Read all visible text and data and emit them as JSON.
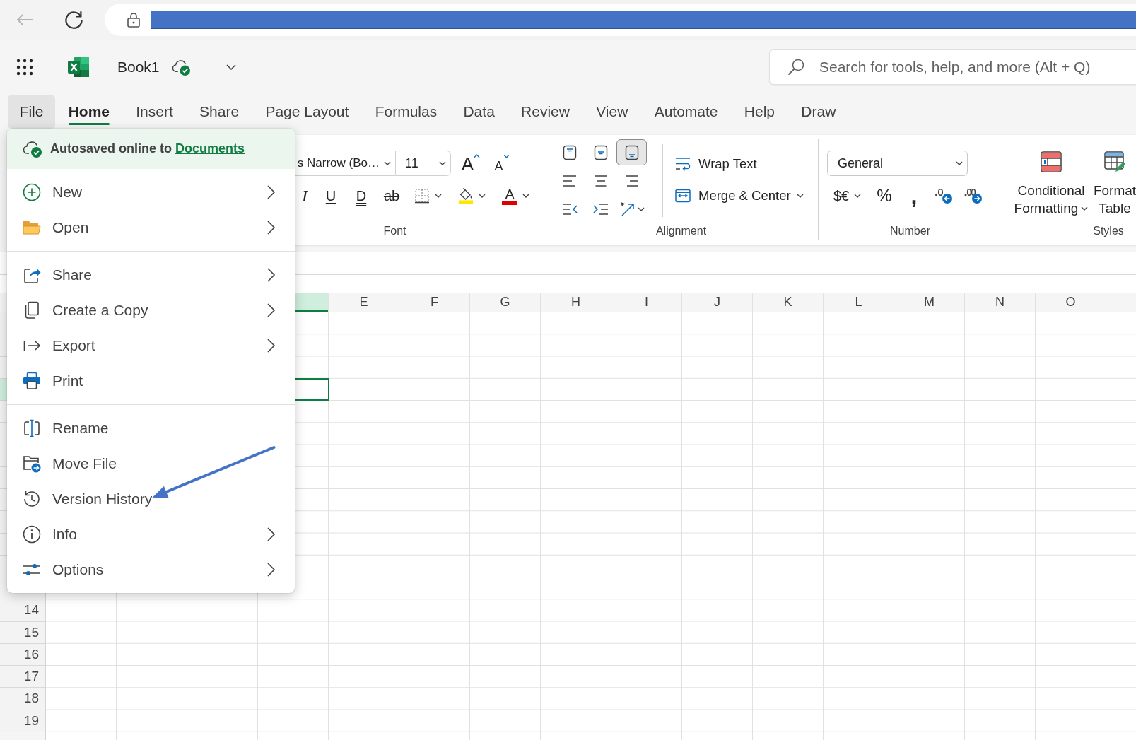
{
  "browser": {
    "back_button": {
      "disabled": true
    }
  },
  "app_bar": {
    "title": "Book1",
    "search": {
      "placeholder": "Search for tools, help, and more (Alt + Q)"
    }
  },
  "file_button": {
    "label": "File",
    "expanded": true
  },
  "tabs": [
    {
      "label": "Home",
      "selected": true
    },
    {
      "label": "Insert",
      "selected": false
    },
    {
      "label": "Share",
      "selected": false
    },
    {
      "label": "Page Layout",
      "selected": false
    },
    {
      "label": "Formulas",
      "selected": false
    },
    {
      "label": "Data",
      "selected": false
    },
    {
      "label": "Review",
      "selected": false
    },
    {
      "label": "View",
      "selected": false
    },
    {
      "label": "Automate",
      "selected": false
    },
    {
      "label": "Help",
      "selected": false
    },
    {
      "label": "Draw",
      "selected": false
    }
  ],
  "ribbon": {
    "font": {
      "font_name": "s Narrow (Bo…",
      "font_size": "11",
      "size_buttons": [
        {
          "kind": "grow",
          "glyph": "A"
        },
        {
          "kind": "shrink",
          "glyph": "A"
        }
      ],
      "format_buttons": [
        {
          "kind": "italic",
          "glyph": "I",
          "dropdown": false
        },
        {
          "kind": "underline",
          "glyph": "U",
          "dropdown": false
        },
        {
          "kind": "double_underline",
          "glyph": "D",
          "dropdown": false
        },
        {
          "kind": "strikethrough",
          "glyph": "ab",
          "dropdown": false
        },
        {
          "kind": "borders",
          "dropdown": true
        },
        {
          "kind": "fill_color",
          "dropdown": true
        },
        {
          "kind": "font_color",
          "glyph": "A",
          "dropdown": true
        }
      ],
      "label": "Font"
    },
    "alignment": {
      "buttons": [
        {
          "kind": "top",
          "selected": false,
          "dropdown": false
        },
        {
          "kind": "middle",
          "selected": false,
          "dropdown": false
        },
        {
          "kind": "bottom",
          "selected": true,
          "dropdown": false
        },
        {
          "kind": "left",
          "selected": false,
          "dropdown": false
        },
        {
          "kind": "center",
          "selected": false,
          "dropdown": false
        },
        {
          "kind": "right",
          "selected": false,
          "dropdown": false
        },
        {
          "kind": "outdent",
          "selected": false,
          "dropdown": false
        },
        {
          "kind": "indent",
          "selected": false,
          "dropdown": false
        },
        {
          "kind": "orientation",
          "selected": false,
          "dropdown": true
        }
      ],
      "commands": [
        {
          "kind": "wrap",
          "label": "Wrap Text",
          "dropdown": false
        },
        {
          "kind": "merge",
          "label": "Merge & Center",
          "dropdown": true
        }
      ],
      "label": "Alignment"
    },
    "number": {
      "format": "General",
      "buttons": [
        {
          "kind": "currency",
          "glyph": "$€",
          "dropdown": true
        },
        {
          "kind": "percent",
          "glyph": "%",
          "dropdown": false
        },
        {
          "kind": "comma",
          "glyph": ",",
          "dropdown": false
        },
        {
          "kind": "decrease_decimal",
          "dropdown": false
        },
        {
          "kind": "increase_decimal",
          "dropdown": false
        }
      ],
      "label": "Number"
    },
    "styles": {
      "buttons": [
        {
          "kind": "conditional_formatting",
          "lines": [
            "Conditional",
            "Formatting"
          ],
          "dropdown": true
        },
        {
          "kind": "format_table",
          "lines": [
            "Format",
            "Table"
          ],
          "dropdown": false
        }
      ],
      "label": "Styles"
    }
  },
  "file_menu": {
    "status": "Autosaved online to",
    "link": "Documents",
    "sections": [
      {
        "items": [
          {
            "label": "New",
            "submenu": true
          },
          {
            "label": "Open",
            "submenu": true
          }
        ]
      },
      {
        "items": [
          {
            "label": "Share",
            "submenu": true
          },
          {
            "label": "Create a Copy",
            "submenu": true
          },
          {
            "label": "Export",
            "submenu": true
          },
          {
            "label": "Print",
            "submenu": false
          }
        ]
      },
      {
        "items": [
          {
            "label": "Rename",
            "submenu": false
          },
          {
            "label": "Move File",
            "submenu": false
          },
          {
            "label": "Version History",
            "submenu": false
          },
          {
            "label": "Info",
            "submenu": true
          },
          {
            "label": "Options",
            "submenu": true
          }
        ]
      }
    ]
  },
  "sheet": {
    "columns": [
      {
        "selected": true
      },
      {
        "label": "E",
        "selected": false
      },
      {
        "label": "F",
        "selected": false
      },
      {
        "label": "G",
        "selected": false
      },
      {
        "label": "H",
        "selected": false
      },
      {
        "label": "I",
        "selected": false
      },
      {
        "label": "J",
        "selected": false
      },
      {
        "label": "K",
        "selected": false
      },
      {
        "label": "L",
        "selected": false
      },
      {
        "label": "M",
        "selected": false
      },
      {
        "label": "N",
        "selected": false
      },
      {
        "label": "O",
        "selected": false
      }
    ],
    "rows": [
      {
        "selected": false
      },
      {
        "selected": false
      },
      {
        "selected": false
      },
      {
        "selected": true
      },
      {
        "selected": false
      },
      {
        "selected": false
      },
      {
        "selected": false
      },
      {
        "selected": false
      },
      {
        "selected": false
      },
      {
        "selected": false
      },
      {
        "selected": false
      },
      {
        "selected": false
      },
      {
        "selected": false
      },
      {
        "label": "14",
        "selected": false
      },
      {
        "label": "15",
        "selected": false
      },
      {
        "label": "16",
        "selected": false
      },
      {
        "label": "17",
        "selected": false
      },
      {
        "label": "18",
        "selected": false
      },
      {
        "label": "19",
        "selected": false
      }
    ]
  }
}
